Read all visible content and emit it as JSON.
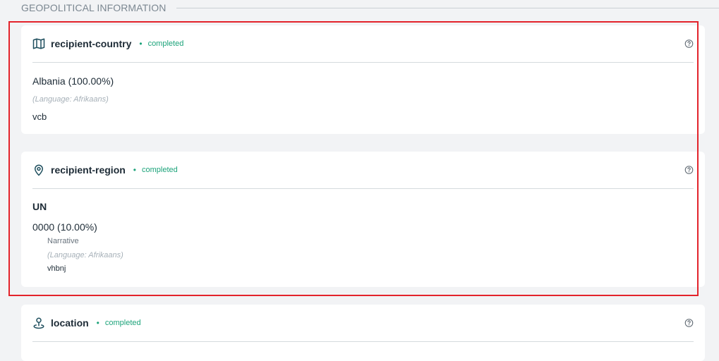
{
  "section": {
    "title": "GEOPOLITICAL INFORMATION"
  },
  "cards": {
    "recipient_country": {
      "title": "recipient-country",
      "status": "completed",
      "icon": "map-icon",
      "value": "Albania (100.00%)",
      "language": "(Language: Afrikaans)",
      "narrative": "vcb"
    },
    "recipient_region": {
      "title": "recipient-region",
      "status": "completed",
      "icon": "location-pin-icon",
      "code": "UN",
      "value": "0000 (10.00%)",
      "narrative_label": "Narrative",
      "language": "(Language: Afrikaans)",
      "narrative": "vhbnj"
    },
    "location": {
      "title": "location",
      "status": "completed",
      "icon": "map-marker-icon"
    }
  },
  "colors": {
    "accent_green": "#1ca37a",
    "highlight_red": "#e3232b",
    "icon_teal": "#1f4f5e"
  }
}
